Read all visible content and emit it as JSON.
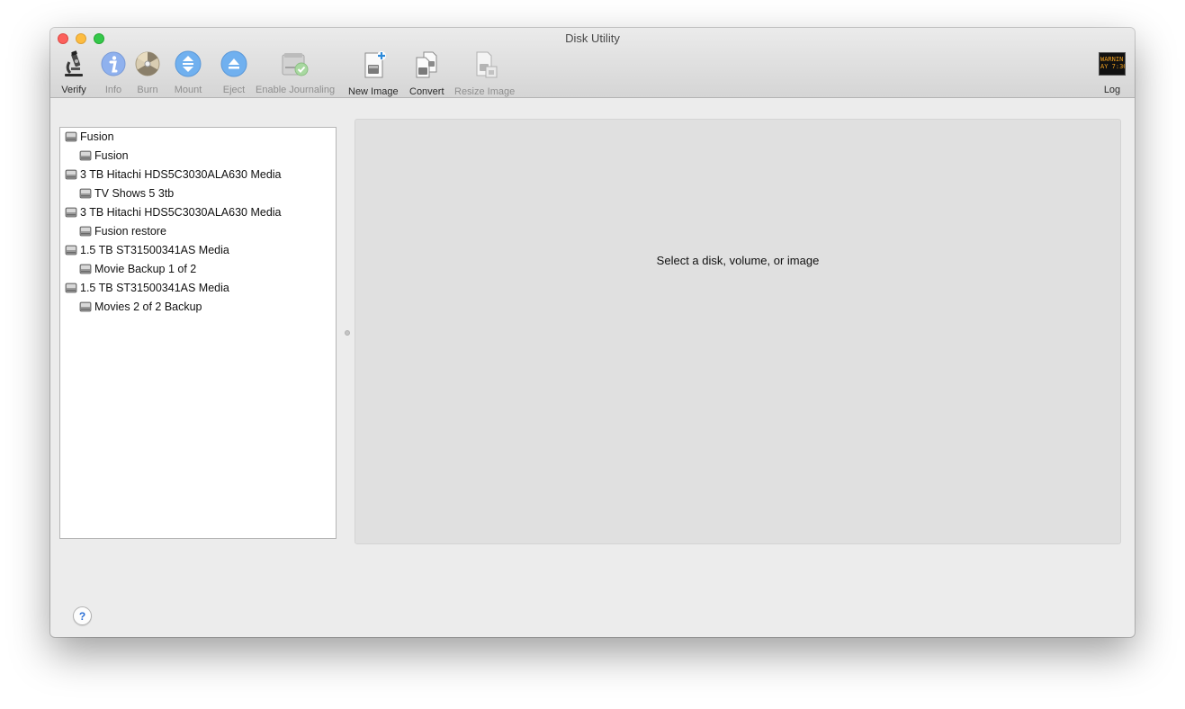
{
  "window": {
    "title": "Disk Utility"
  },
  "toolbar": {
    "verify": "Verify",
    "info": "Info",
    "burn": "Burn",
    "mount": "Mount",
    "eject": "Eject",
    "enable_journaling": "Enable Journaling",
    "new_image": "New Image",
    "convert": "Convert",
    "resize_image": "Resize Image",
    "log": "Log",
    "log_icon_line1": "WARNIN",
    "log_icon_line2": "AY 7:36"
  },
  "sidebar": {
    "items": [
      {
        "label": "Fusion",
        "level": 0
      },
      {
        "label": "Fusion",
        "level": 1
      },
      {
        "label": "3 TB Hitachi HDS5C3030ALA630 Media",
        "level": 0
      },
      {
        "label": "TV Shows 5 3tb",
        "level": 1
      },
      {
        "label": "3 TB Hitachi HDS5C3030ALA630 Media",
        "level": 0
      },
      {
        "label": "Fusion restore",
        "level": 1
      },
      {
        "label": "1.5 TB ST31500341AS Media",
        "level": 0
      },
      {
        "label": "Movie Backup 1 of 2",
        "level": 1
      },
      {
        "label": "1.5 TB ST31500341AS Media",
        "level": 0
      },
      {
        "label": "Movies 2 of 2 Backup",
        "level": 1
      }
    ]
  },
  "detail": {
    "message": "Select a disk, volume, or image"
  },
  "help": {
    "label": "?"
  }
}
